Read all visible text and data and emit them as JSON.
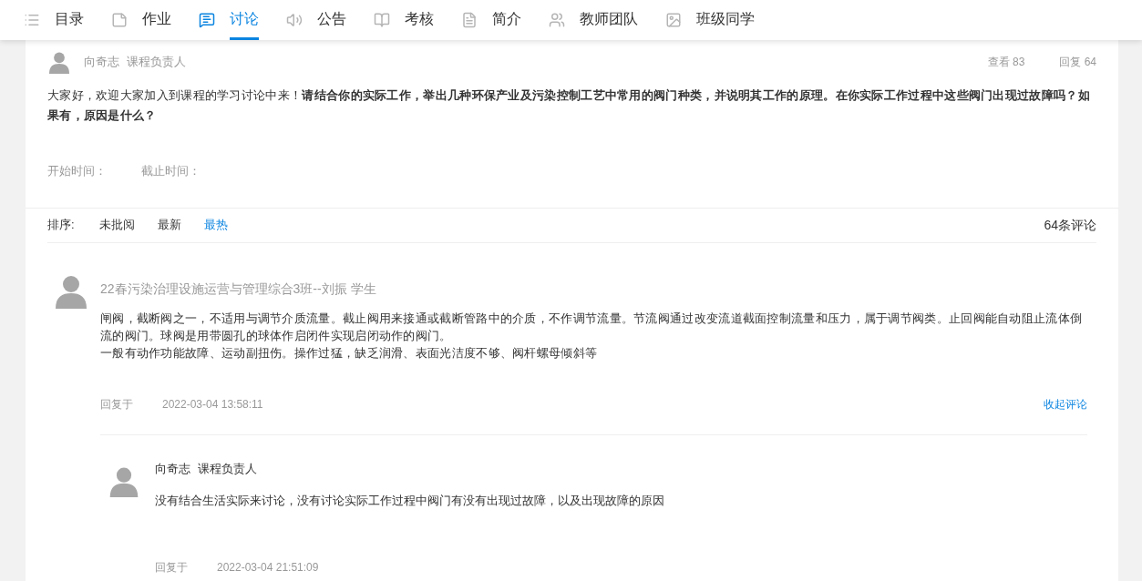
{
  "nav": [
    {
      "label": "目录",
      "selected": false
    },
    {
      "label": "作业",
      "selected": false
    },
    {
      "label": "讨论",
      "selected": true
    },
    {
      "label": "公告",
      "selected": false
    },
    {
      "label": "考核",
      "selected": false
    },
    {
      "label": "简介",
      "selected": false
    },
    {
      "label": "教师团队",
      "selected": false
    },
    {
      "label": "班级同学",
      "selected": false
    }
  ],
  "topic": {
    "author": "向奇志",
    "role": "课程负责人",
    "views": "查看 83",
    "replies": "回复 64",
    "content": "大家好，欢迎大家加入到课程的学习讨论中来！**请结合你的实际工作，举出几种环保产业及污染控制工艺中常用的阀门种类，并说明其工作的原理。在你实际工作过程中这些阀门出现过故障吗？如果有，原因是什么？**",
    "start_label": "开始时间：",
    "end_label": "截止时间："
  },
  "sort": {
    "label": "排序:",
    "options": [
      {
        "label": "未批阅",
        "selected": false
      },
      {
        "label": "最新",
        "selected": false
      },
      {
        "label": "最热",
        "selected": true
      }
    ],
    "count": "64条评论"
  },
  "comments": [
    {
      "author": "22春污染治理设施运营与管理综合3班--刘振 学生",
      "lines": [
        "闸阀，截断阀之一，不适用与调节介质流量。截止阀用来接通或截断管路中的介质，不作调节流量。节流阀通过改变流道截面控制流量和压力，属于调节阀类。止回阀能自动阻止流体倒流的阀门。球阀是用带圆孔的球体作启闭件实现启闭动作的阀门。",
        "一般有动作功能故障、运动副扭伤。操作过猛，缺乏润滑、表面光洁度不够、阀杆螺母倾斜等"
      ],
      "reply_label": "回复于",
      "time": "2022-03-04 13:58:11",
      "collapse": "收起评论",
      "replies": [
        {
          "author": "向奇志",
          "role": "课程负责人",
          "text": "没有结合生活实际来讨论，没有讨论实际工作过程中阀门有没有出现过故障，以及出现故障的原因",
          "reply_label": "回复于",
          "time": "2022-03-04 21:51:09"
        }
      ]
    }
  ]
}
